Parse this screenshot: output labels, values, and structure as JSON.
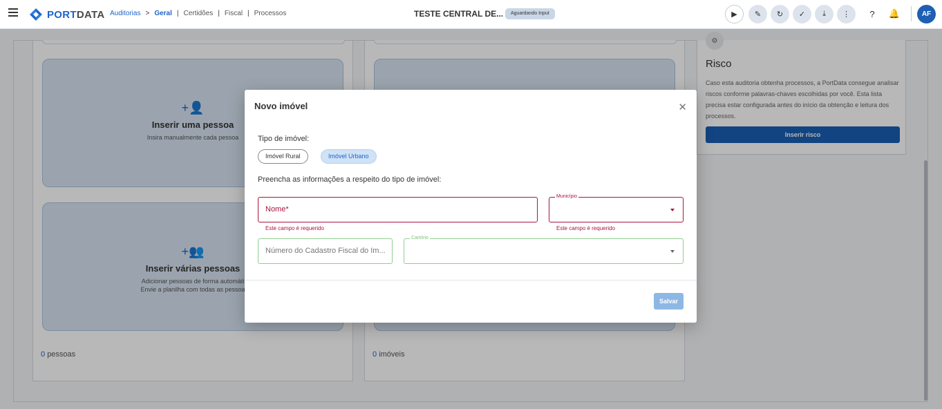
{
  "header": {
    "logo_text_1": "PORT",
    "logo_text_2": "DATA",
    "breadcrumbs": {
      "auditorias": "Auditorias",
      "arrow": ">",
      "geral": "Geral",
      "certidoes": "Certidões",
      "fiscal": "Fiscal",
      "processos": "Processos",
      "sep": "|"
    },
    "title": "TESTE CENTRAL DE...",
    "status": "Aguardando Input",
    "avatar": "AF"
  },
  "background": {
    "left_cards": [
      {
        "icon": "+👤",
        "title": "Inserir uma pessoa",
        "subtitle": "Insira manualmente cada pessoa"
      },
      {
        "icon": "+👥",
        "title": "Inserir várias pessoas",
        "subtitle_1": "Adicionar pessoas de forma automáti",
        "subtitle_2": "Envie a planilha com todas as pessoa"
      }
    ],
    "left_count": {
      "number": "0",
      "label": "pessoas"
    },
    "mid_count": {
      "number": "0",
      "label": "imóveis"
    },
    "risk": {
      "title": "Risco",
      "description": "Caso esta auditoria obtenha processos, a PortData consegue analisar riscos conforme palavras-chaves escolhidas por você. Esta lista precisa estar configurada antes do início da obtenção e leitura dos processos.",
      "button": "Inserir risco"
    }
  },
  "modal": {
    "title": "Novo imóvel",
    "close": "✕",
    "tipo_label": "Tipo de imóvel:",
    "chips": {
      "rural": "Imóvel Rural",
      "urbano": "Imóvel Urbano"
    },
    "selected_chip": "Imóvel Urbano",
    "preencha": "Preencha as informações a respeito do tipo de imóvel:",
    "fields": {
      "nome": {
        "placeholder": "Nome*",
        "error": "Este campo é requerido"
      },
      "municipio": {
        "label": "Município",
        "value": "",
        "error": "Este campo é requerido"
      },
      "cadastro": {
        "placeholder": "Número do Cadastro Fiscal do Im..."
      },
      "cartorio": {
        "label": "Cartório",
        "value": ""
      }
    },
    "save": "Salvar"
  },
  "colors": {
    "primary": "#1e64c8",
    "error": "#a8143c",
    "success_border": "#8fcf8f"
  }
}
